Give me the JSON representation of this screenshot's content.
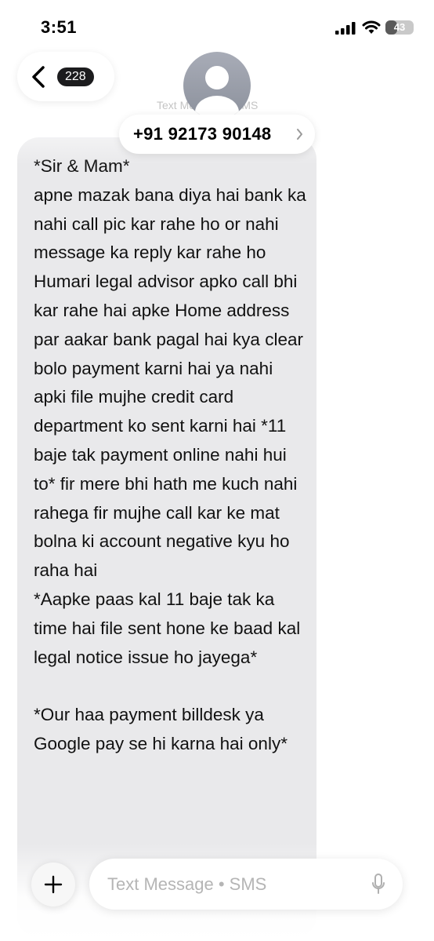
{
  "status_bar": {
    "time": "3:51",
    "battery": "43",
    "battery_level": 0.43,
    "icons": [
      "signal-icon",
      "wifi-icon",
      "battery-icon"
    ]
  },
  "nav": {
    "back_icon": "chevron-left-icon",
    "unread_count": "228",
    "subtitle": "Text Message • SMS",
    "contact_name": "+91 92173 90148",
    "contact_chevron": "chevron-right-icon",
    "avatar_icon": "person-icon"
  },
  "message": {
    "text": "*Sir & Mam*\napne mazak bana diya hai bank ka nahi call pic kar rahe ho or nahi message ka reply kar rahe ho Humari legal advisor apko call bhi kar rahe hai apke Home address par aakar bank pagal hai kya clear bolo payment karni hai ya nahi apki file mujhe credit card department ko sent karni hai *11 baje tak payment online nahi hui to* fir mere bhi hath me kuch nahi rahega fir mujhe call kar ke mat bolna ki account negative kyu ho raha hai\n*Aapke paas kal 11 baje tak ka time hai file sent hone ke baad kal legal notice issue ho jayega*\n\n*Our haa payment billdesk ya Google pay se hi karna hai only*"
  },
  "composer": {
    "placeholder": "Text Message • SMS",
    "plus_icon": "plus-icon",
    "mic_icon": "microphone-icon"
  },
  "colors": {
    "bubble": "#e9e9eb",
    "badge": "#1c1c1e",
    "placeholder": "#b5b5b5"
  }
}
